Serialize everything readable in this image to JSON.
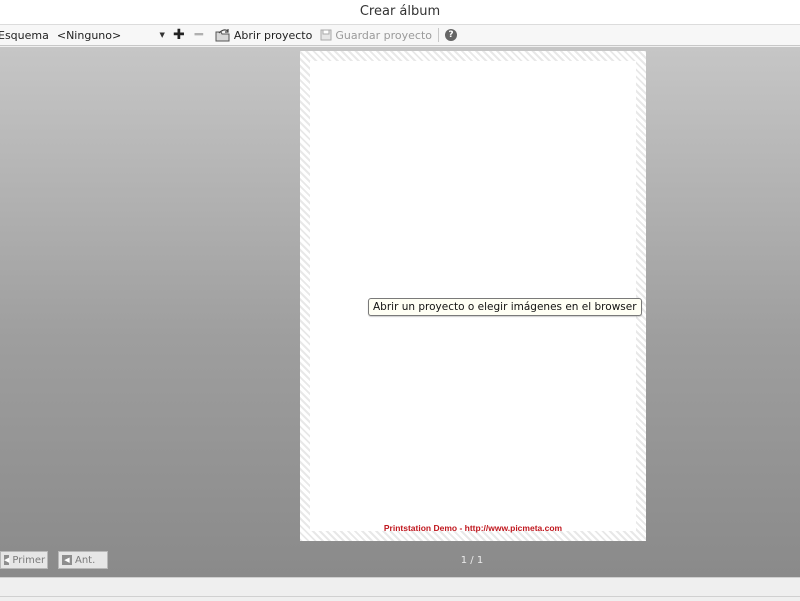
{
  "window": {
    "title": "Crear álbum"
  },
  "toolbar": {
    "scheme_label": "Esquema",
    "scheme_value": "<Ninguno>",
    "open_project_label": "Abrir proyecto",
    "save_project_label": "Guardar proyecto"
  },
  "canvas": {
    "prompt": "Abrir un proyecto o elegir imágenes en el browser",
    "watermark": "Printstation Demo - http://www.picmeta.com"
  },
  "navigation": {
    "first_label": "Primer",
    "prev_label": "Ant.",
    "page_counter": "1 / 1"
  },
  "colors": {
    "watermark": "#c0161d",
    "workspace": "#9e9e9e"
  }
}
